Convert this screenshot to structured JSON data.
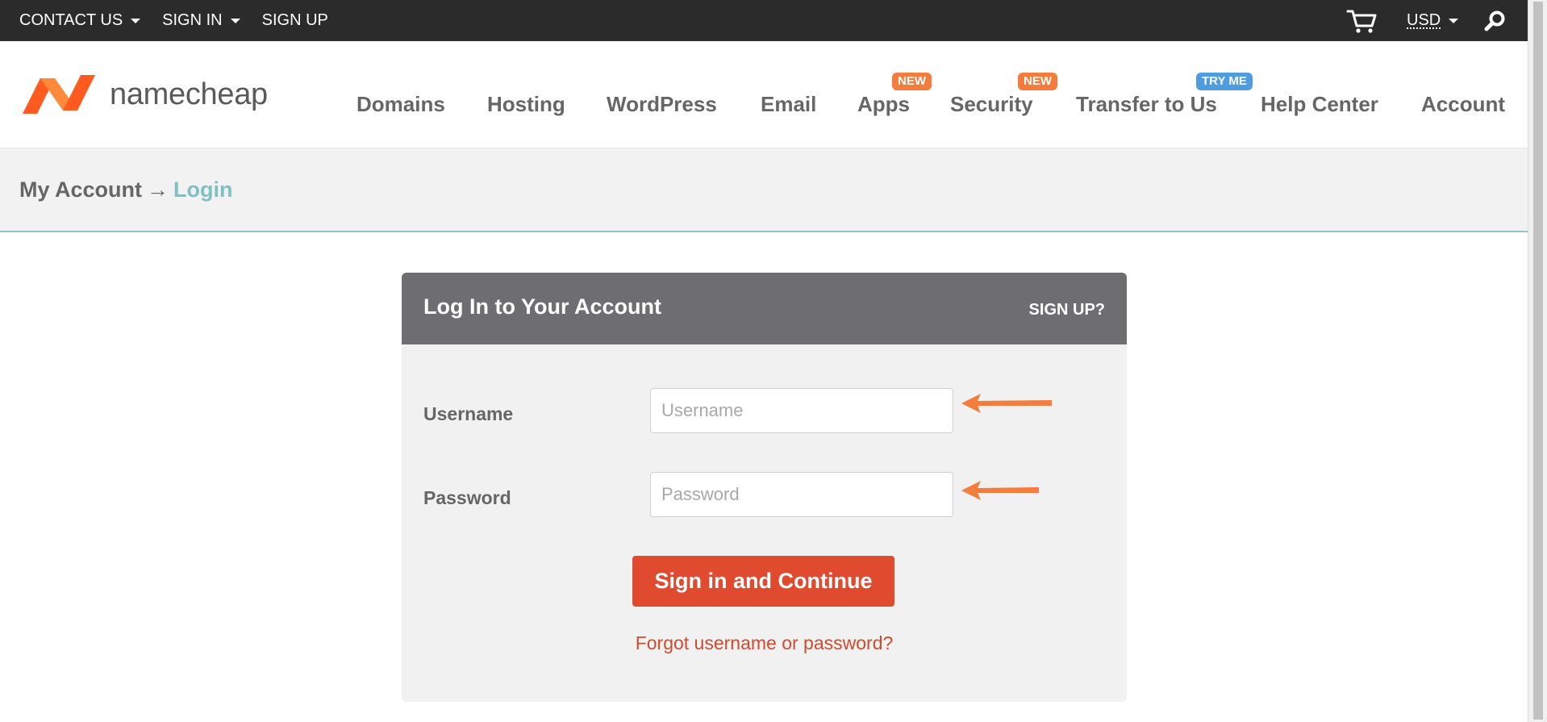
{
  "topbar": {
    "contact_label": "CONTACT US",
    "signin_label": "SIGN IN",
    "signup_label": "SIGN UP",
    "currency": "USD"
  },
  "header": {
    "logo_text": "namecheap",
    "nav": [
      {
        "label": "Domains"
      },
      {
        "label": "Hosting"
      },
      {
        "label": "WordPress"
      },
      {
        "label": "Email"
      },
      {
        "label": "Apps",
        "badge": "NEW"
      },
      {
        "label": "Security",
        "badge": "NEW"
      },
      {
        "label": "Transfer to Us",
        "badge": "TRY ME"
      },
      {
        "label": "Help Center"
      },
      {
        "label": "Account"
      }
    ]
  },
  "breadcrumb": {
    "parent": "My Account",
    "separator": "→",
    "current": "Login"
  },
  "login": {
    "title": "Log In to Your Account",
    "signup_link": "SIGN UP?",
    "username_label": "Username",
    "username_placeholder": "Username",
    "password_label": "Password",
    "password_placeholder": "Password",
    "submit_label": "Sign in and Continue",
    "forgot_link": "Forgot username or password?"
  },
  "colors": {
    "topbar_bg": "#2b2b2b",
    "accent_orange": "#f47c3c",
    "button_red": "#e04a2f",
    "teal": "#7fc0c4",
    "badge_blue": "#4e9be0"
  }
}
